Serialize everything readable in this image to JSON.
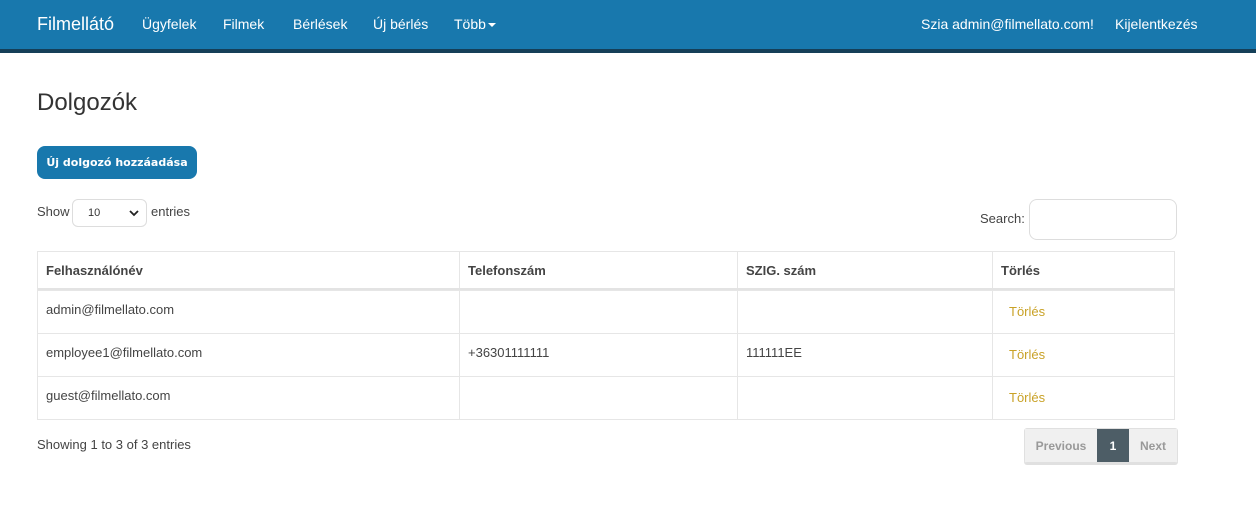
{
  "nav": {
    "brand": "Filmellátó",
    "items": [
      {
        "label": "Ügyfelek"
      },
      {
        "label": "Filmek"
      },
      {
        "label": "Bérlések"
      },
      {
        "label": "Új bérlés"
      },
      {
        "label": "Több"
      }
    ],
    "greeting": "Szia admin@filmellato.com!",
    "logout": "Kijelentkezés"
  },
  "page": {
    "title": "Dolgozók",
    "add_button": "Új dolgozó hozzáadása"
  },
  "table_controls": {
    "show_label": "Show",
    "entries_label": "entries",
    "page_size": "10",
    "search_label": "Search:",
    "search_value": ""
  },
  "table": {
    "columns": [
      "Felhasználónév",
      "Telefonszám",
      "SZIG. szám",
      "Törlés"
    ],
    "rows": [
      {
        "username": "admin@filmellato.com",
        "phone": "",
        "id_number": "",
        "action": "Törlés"
      },
      {
        "username": "employee1@filmellato.com",
        "phone": "+36301111111",
        "id_number": "111111EE",
        "action": "Törlés"
      },
      {
        "username": "guest@filmellato.com",
        "phone": "",
        "id_number": "",
        "action": "Törlés"
      }
    ]
  },
  "footer": {
    "info": "Showing 1 to 3 of 3 entries",
    "previous": "Previous",
    "current_page": "1",
    "next": "Next"
  },
  "colors": {
    "navbar": "#1878ad",
    "navbar_border": "#153f58",
    "accent_link": "#c9a227",
    "active_page": "#4d5d66"
  }
}
